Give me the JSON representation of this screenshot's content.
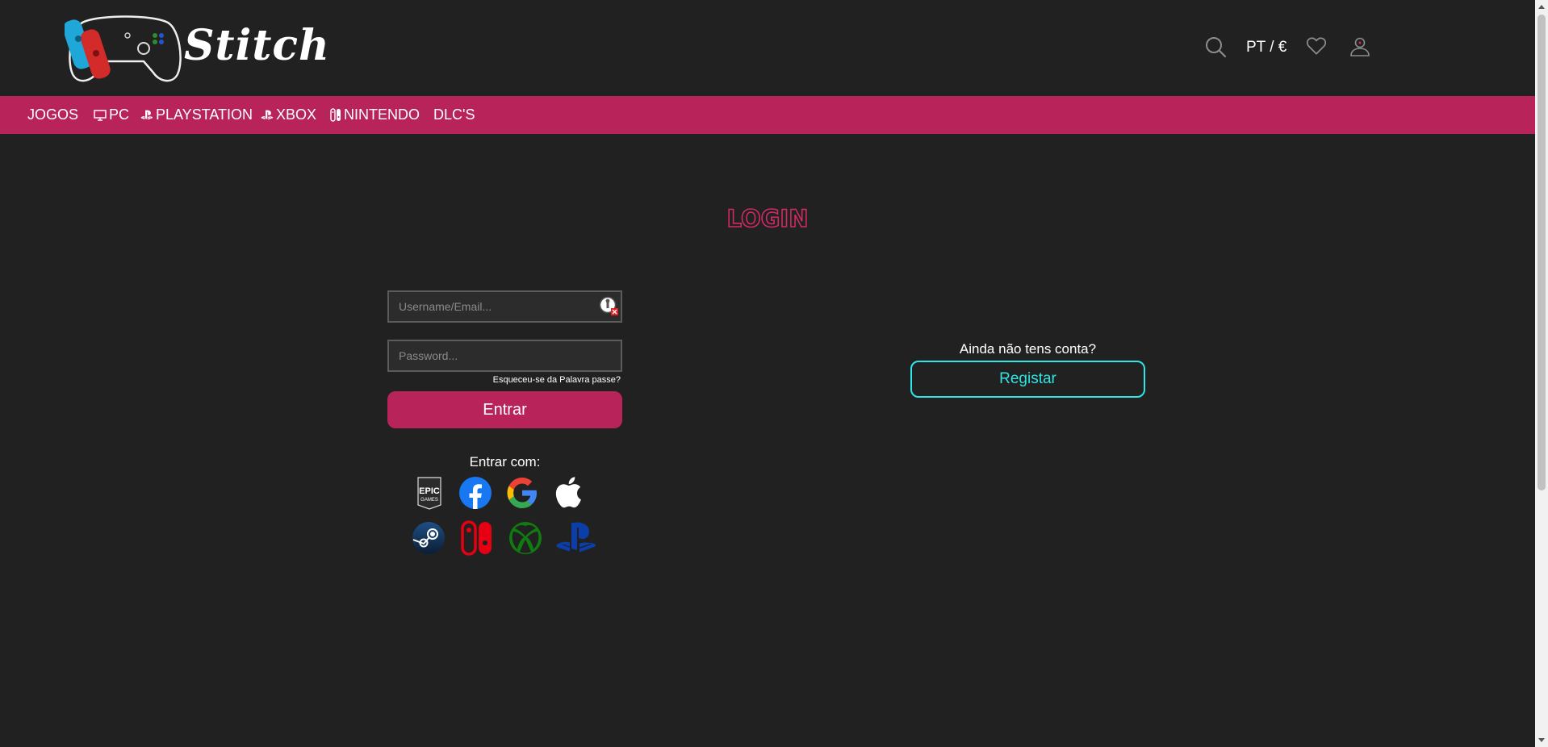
{
  "header": {
    "logo_text": "Stitch",
    "locale": "PT / €",
    "icons": [
      "search-icon",
      "heart-icon",
      "user-icon"
    ]
  },
  "nav": {
    "items": [
      {
        "label": "JOGOS",
        "icon": ""
      },
      {
        "label": "PC",
        "icon": "monitor-icon"
      },
      {
        "label": "PLAYSTATION",
        "icon": "playstation-icon"
      },
      {
        "label": "XBOX",
        "icon": "playstation-icon"
      },
      {
        "label": "NINTENDO",
        "icon": "switch-icon"
      },
      {
        "label": "DLC'S",
        "icon": ""
      }
    ]
  },
  "login": {
    "title": "LOGIN",
    "username_placeholder": "Username/Email...",
    "password_placeholder": "Password...",
    "forgot": "Esqueceu-se da Palavra passe?",
    "submit": "Entrar",
    "social_label": "Entrar com:",
    "epic_text_1": "EPIC",
    "epic_text_2": "GAMES",
    "social_providers": [
      "epic-games",
      "facebook",
      "google",
      "apple",
      "steam",
      "nintendo-switch",
      "xbox",
      "playstation"
    ]
  },
  "register": {
    "prompt": "Ainda não tens conta?",
    "button": "Registar"
  },
  "colors": {
    "background": "#212121",
    "accent": "#b8245a",
    "register_accent": "#2ee6e6"
  }
}
